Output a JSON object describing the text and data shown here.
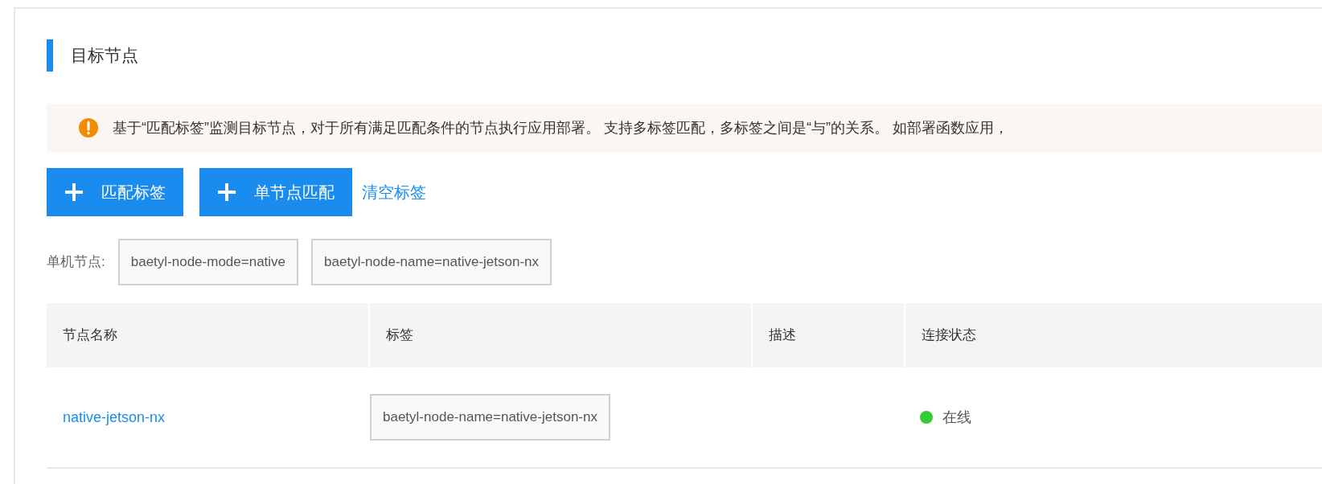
{
  "section": {
    "title": "目标节点"
  },
  "notice": {
    "text": "基于“匹配标签”监测目标节点，对于所有满足匹配条件的节点执行应用部署。 支持多标签匹配，多标签之间是“与”的关系。 如部署函数应用，"
  },
  "actions": [
    {
      "kind": "primary",
      "label": "匹配标签"
    },
    {
      "kind": "primary",
      "label": "单节点匹配"
    },
    {
      "kind": "link",
      "label": "清空标签"
    }
  ],
  "selected_tags": {
    "label": "单机节点:",
    "tags": [
      "baetyl-node-mode=native",
      "baetyl-node-name=native-jetson-nx"
    ]
  },
  "table": {
    "columns": [
      "节点名称",
      "标签",
      "描述",
      "连接状态"
    ],
    "rows": [
      {
        "name": "native-jetson-nx",
        "tags": [
          "baetyl-node-name=native-jetson-nx"
        ],
        "status": "在线",
        "color": "#33cc33"
      }
    ]
  }
}
